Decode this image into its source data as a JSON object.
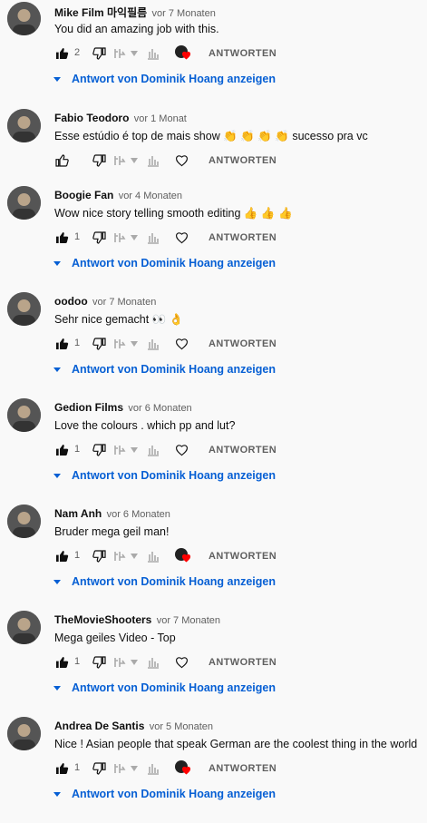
{
  "reply_label": "ANTWORTEN",
  "view_replies_label": "Antwort von Dominik Hoang anzeigen",
  "colors": {
    "link": "#065fd4",
    "muted": "#606060",
    "heart": "#ff0000"
  },
  "comments": [
    {
      "author": "Mike Film 마익필름",
      "time": "vor 7 Monaten",
      "text": "You did an amazing job with this.",
      "likes": "2",
      "liked": true,
      "heart_state": "creator-heart",
      "has_replies": true
    },
    {
      "author": "Fabio Teodoro",
      "time": "vor 1 Monat",
      "text": "Esse estúdio é top de mais show 👏 👏 👏 👏 sucesso pra vc",
      "likes": "",
      "liked": false,
      "heart_state": "empty",
      "has_replies": false
    },
    {
      "author": "Boogie Fan",
      "time": "vor 4 Monaten",
      "text": "Wow nice story telling smooth editing 👍 👍 👍",
      "likes": "1",
      "liked": true,
      "heart_state": "empty",
      "has_replies": true
    },
    {
      "author": "oodoo",
      "time": "vor 7 Monaten",
      "text": "Sehr nice gemacht 👀 👌",
      "likes": "1",
      "liked": true,
      "heart_state": "empty",
      "has_replies": true
    },
    {
      "author": "Gedion Films",
      "time": "vor 6 Monaten",
      "text": "Love the colours . which pp and lut?",
      "likes": "1",
      "liked": true,
      "heart_state": "empty",
      "has_replies": true
    },
    {
      "author": "Nam Anh",
      "time": "vor 6 Monaten",
      "text": "Bruder mega geil man!",
      "likes": "1",
      "liked": true,
      "heart_state": "creator-heart",
      "has_replies": true
    },
    {
      "author": "TheMovieShooters",
      "time": "vor 7 Monaten",
      "text": "Mega geiles Video - Top",
      "likes": "1",
      "liked": true,
      "heart_state": "empty",
      "has_replies": true
    },
    {
      "author": "Andrea De Santis",
      "time": "vor 5 Monaten",
      "text": "Nice ! Asian people that speak German are the coolest thing in the world",
      "likes": "1",
      "liked": true,
      "heart_state": "creator-heart",
      "has_replies": true
    }
  ]
}
